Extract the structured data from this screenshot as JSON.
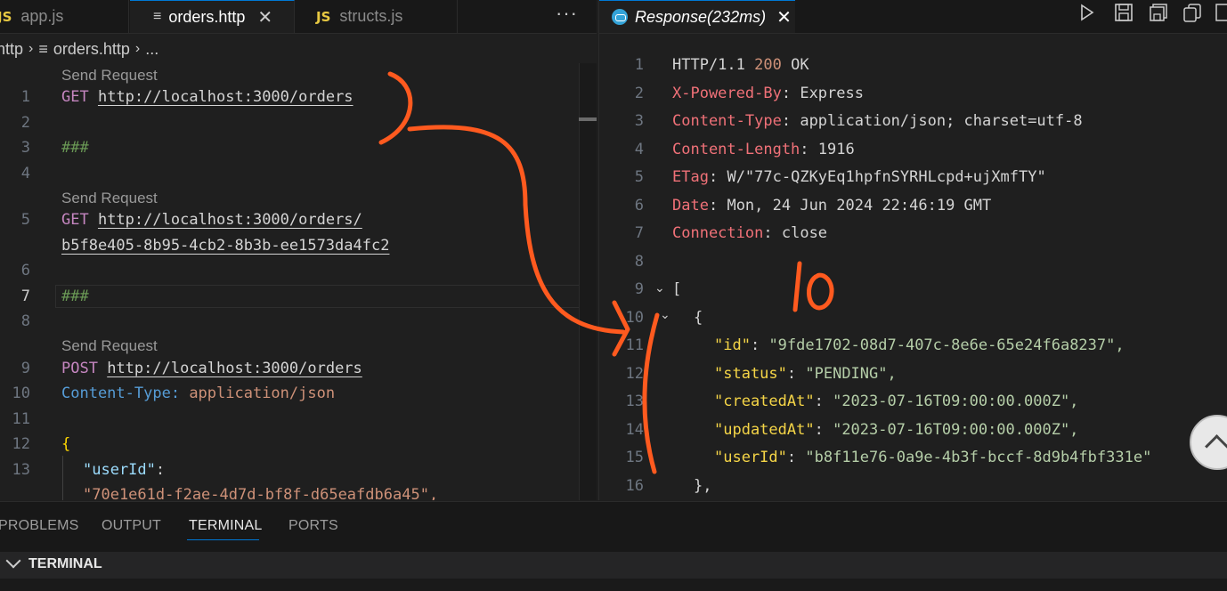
{
  "left_tabs": {
    "app": "app.js",
    "orders": "orders.http",
    "structs": "structs.js",
    "js_badge": "JS",
    "js_badge_2": "JS",
    "close": "✕",
    "more": "···"
  },
  "breadcrumb": {
    "folder": "http",
    "file": "orders.http",
    "rest": "..."
  },
  "editor": {
    "lens_label": "Send Request",
    "lines": {
      "l1": {
        "method": "GET",
        "url": "http://localhost:3000/orders"
      },
      "l3": "###",
      "l5": {
        "method": "GET",
        "url_a": "http://localhost:3000/orders/",
        "url_b": "b5f8e405-8b95-4cb2-8b3b-ee1573da4fc2"
      },
      "l7": "###",
      "l9": {
        "method": "POST",
        "url": "http://localhost:3000/orders"
      },
      "l10": {
        "name": "Content-Type:",
        "value": "application/json"
      },
      "l12": "{",
      "l13": {
        "key": "\"userId\"",
        "colon": ":"
      },
      "l13b": "\"70e1e61d-f2ae-4d7d-bf8f-d65eafdb6a45\","
    },
    "line_numbers": [
      "1",
      "2",
      "3",
      "4",
      "5",
      "6",
      "7",
      "8",
      "9",
      "10",
      "11",
      "12",
      "13"
    ]
  },
  "response_tab": {
    "title": "Response(232ms)",
    "close": "✕"
  },
  "response": {
    "line_numbers": [
      "1",
      "2",
      "3",
      "4",
      "5",
      "6",
      "7",
      "8",
      "9",
      "10",
      "11",
      "12",
      "13",
      "14",
      "15",
      "16"
    ],
    "status": {
      "proto": "HTTP/1.1",
      "code": "200",
      "text": "OK"
    },
    "headers": [
      {
        "name": "X-Powered-By",
        "value": "Express"
      },
      {
        "name": "Content-Type",
        "value": "application/json; charset=utf-8"
      },
      {
        "name": "Content-Length",
        "value": "1916"
      },
      {
        "name": "ETag",
        "value": "W/\"77c-QZKyEq1hpfnSYRHLcpd+ujXmfTY\""
      },
      {
        "name": "Date",
        "value": "Mon, 24 Jun 2024 22:46:19 GMT"
      },
      {
        "name": "Connection",
        "value": "close"
      }
    ],
    "sep": ":",
    "open_bracket": "[",
    "open_brace": "{",
    "body": [
      {
        "key": "\"id\"",
        "value": "\"9fde1702-08d7-407c-8e6e-65e24f6a8237\","
      },
      {
        "key": "\"status\"",
        "value": "\"PENDING\","
      },
      {
        "key": "\"createdAt\"",
        "value": "\"2023-07-16T09:00:00.000Z\","
      },
      {
        "key": "\"updatedAt\"",
        "value": "\"2023-07-16T09:00:00.000Z\","
      },
      {
        "key": "\"userId\"",
        "value": "\"b8f11e76-0a9e-4b3f-bccf-8d9b4fbf331e\""
      }
    ],
    "close_brace": "},"
  },
  "bottom_panel": {
    "tabs": [
      "PROBLEMS",
      "OUTPUT",
      "TERMINAL",
      "PORTS"
    ],
    "section_title": "TERMINAL"
  },
  "annotation": {
    "text": "10",
    "color": "#ff5a1f"
  }
}
